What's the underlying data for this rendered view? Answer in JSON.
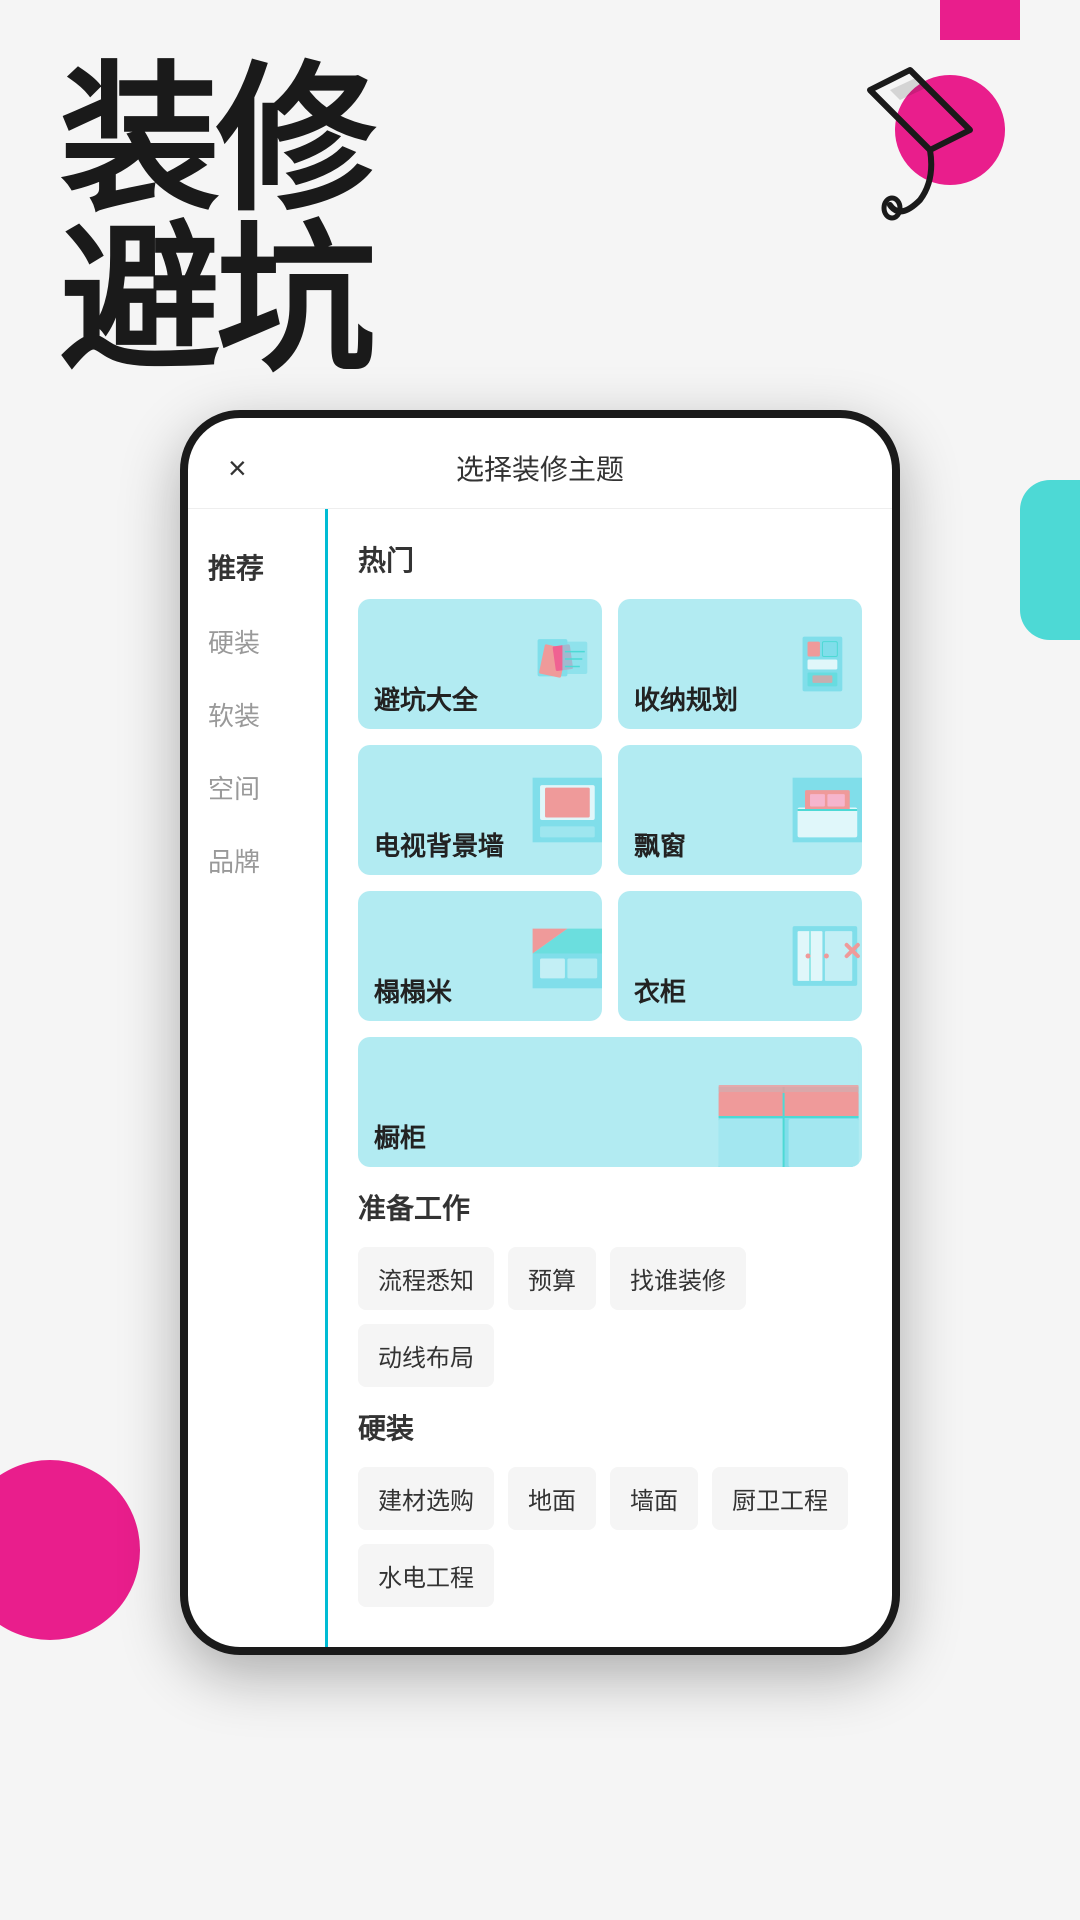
{
  "page": {
    "bg_color": "#ffffff"
  },
  "hero": {
    "title_line1": "装修",
    "title_line2": "避坑",
    "accent_color": "#e91e8c",
    "teal_color": "#4dd9d5"
  },
  "modal": {
    "close_label": "×",
    "title": "选择装修主题",
    "sidebar": {
      "items": [
        {
          "label": "推荐",
          "active": true
        },
        {
          "label": "硬装",
          "active": false
        },
        {
          "label": "软装",
          "active": false
        },
        {
          "label": "空间",
          "active": false
        },
        {
          "label": "品牌",
          "active": false
        }
      ]
    },
    "sections": [
      {
        "title": "热门",
        "type": "grid",
        "items": [
          {
            "label": "避坑大全",
            "style": "avoid"
          },
          {
            "label": "收纳规划",
            "style": "storage"
          },
          {
            "label": "电视背景墙",
            "style": "tv"
          },
          {
            "label": "飘窗",
            "style": "bay"
          },
          {
            "label": "榻榻米",
            "style": "tatami"
          },
          {
            "label": "衣柜",
            "style": "wardrobe"
          },
          {
            "label": "橱柜",
            "style": "cabinet",
            "full": true
          }
        ]
      },
      {
        "title": "准备工作",
        "type": "tags",
        "items": [
          {
            "label": "流程悉知"
          },
          {
            "label": "预算"
          },
          {
            "label": "找谁装修"
          },
          {
            "label": "动线布局"
          }
        ]
      },
      {
        "title": "硬装",
        "type": "tags",
        "items": [
          {
            "label": "建材选购"
          },
          {
            "label": "地面"
          },
          {
            "label": "墙面"
          },
          {
            "label": "厨卫工程"
          },
          {
            "label": "水电工程"
          }
        ]
      }
    ]
  }
}
